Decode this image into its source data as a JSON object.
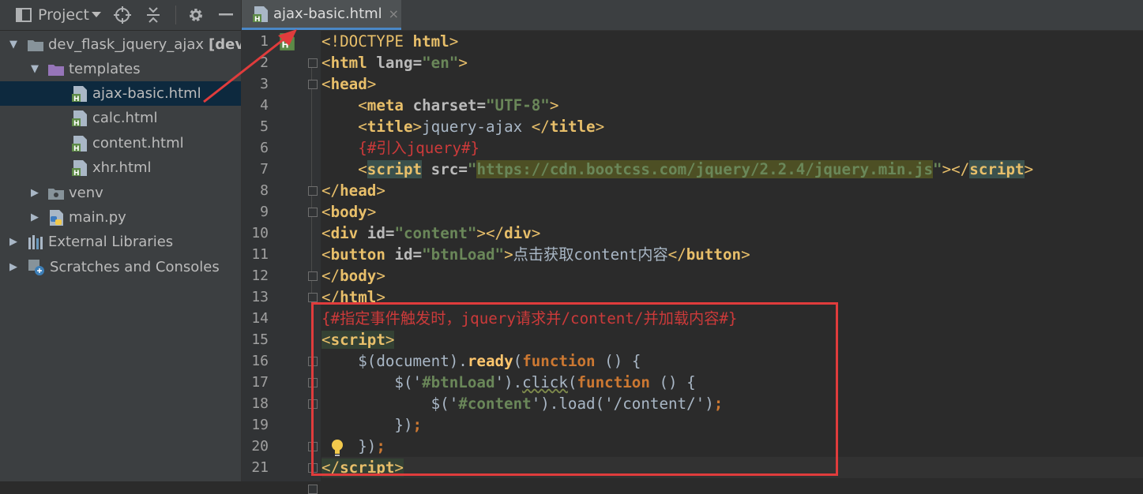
{
  "toolbar": {
    "project_label": "Project",
    "icons": [
      "project-icon",
      "chevron-down-icon",
      "locate-icon",
      "collapse-icon",
      "gear-icon",
      "minimize-icon"
    ]
  },
  "tree": {
    "items": [
      {
        "label": "dev_flask_jquery_ajax",
        "suffix": "[dev_f",
        "icon": "folder-icon",
        "level": 0,
        "expanded": true
      },
      {
        "label": "templates",
        "icon": "purple-folder-icon",
        "level": 1,
        "expanded": true
      },
      {
        "label": "ajax-basic.html",
        "icon": "html-file-icon",
        "level": 2,
        "selected": true
      },
      {
        "label": "calc.html",
        "icon": "html-file-icon",
        "level": 2
      },
      {
        "label": "content.html",
        "icon": "html-file-icon",
        "level": 2
      },
      {
        "label": "xhr.html",
        "icon": "html-file-icon",
        "level": 2
      },
      {
        "label": "venv",
        "icon": "folder-icon",
        "level": 1,
        "expanded": false
      },
      {
        "label": "main.py",
        "icon": "python-file-icon",
        "level": 1,
        "expanded": false
      },
      {
        "label": "External Libraries",
        "icon": "library-icon",
        "level": 0,
        "expanded": false
      },
      {
        "label": "Scratches and Consoles",
        "icon": "scratches-icon",
        "level": 0,
        "expanded": false
      }
    ]
  },
  "tab": {
    "label": "ajax-basic.html",
    "close": "×"
  },
  "line_numbers": [
    "1",
    "2",
    "3",
    "4",
    "5",
    "6",
    "7",
    "8",
    "9",
    "10",
    "11",
    "12",
    "13",
    "14",
    "15",
    "16",
    "17",
    "18",
    "19",
    "20",
    "21"
  ],
  "code": {
    "l1_doctype": "<!DOCTYPE ",
    "l1_html": "html",
    "l1_close": ">",
    "lt": "<",
    "gt": ">",
    "lt_slash": "</",
    "eq": "=",
    "tag_html": "html",
    "tag_head": "head",
    "tag_meta": "meta",
    "tag_title": "title",
    "tag_script": "script",
    "tag_body": "body",
    "tag_div": "div",
    "tag_button": "button",
    "attr_lang": "lang",
    "attr_charset": "charset",
    "attr_src": "src",
    "attr_id": "id",
    "val_en": "\"en\"",
    "val_utf8": "\"UTF-8\"",
    "q": "\"",
    "val_url": "https://cdn.bootcss.com/jquery/2.2.4/jquery.min.js",
    "val_content": "\"content\"",
    "val_btnload": "\"btnLoad\"",
    "title_text": "jquery-ajax ",
    "comment_jquery": "{#引入jquery#}",
    "button_text": "点击获取content内容",
    "comment_14": "{#指定事件触发时，jquery请求并/content/并加载内容#}",
    "l16_dollar": "$(",
    "l16_document": "document",
    "l16_rp": ").",
    "l16_ready": "ready",
    "l16_lp": "(",
    "l16_function": "function",
    "l16_tail": " () {",
    "l17_open": "$('",
    "l17_sel": "#btnLoad",
    "l17_close": "').",
    "l17_click": "click",
    "l17_lp": "(",
    "l17_function": "function",
    "l17_tail": " () {",
    "l18_open": "$('",
    "l18_sel": "#content",
    "l18_mid": "').",
    "l18_load": "load",
    "l18_args": "('/content/')",
    "semi": ";",
    "l19_close": "})",
    "l20_close": "})"
  }
}
